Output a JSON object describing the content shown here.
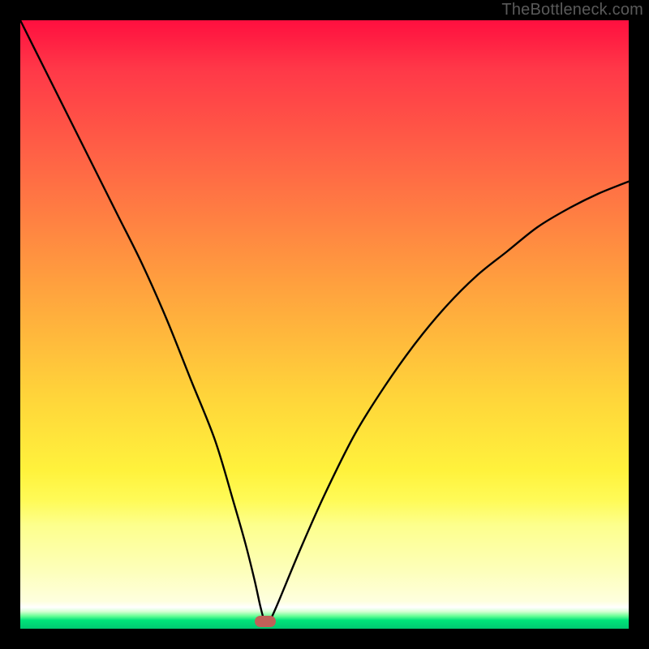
{
  "watermark": "TheBottleneck.com",
  "chart_data": {
    "type": "line",
    "title": "",
    "xlabel": "",
    "ylabel": "",
    "xlim": [
      0,
      100
    ],
    "ylim": [
      0,
      100
    ],
    "series": [
      {
        "name": "bottleneck-curve",
        "x": [
          0,
          4,
          8,
          12,
          16,
          20,
          24,
          28,
          32,
          35,
          37,
          38.5,
          39.5,
          40.2,
          41,
          42,
          46,
          50,
          55,
          60,
          65,
          70,
          75,
          80,
          85,
          90,
          95,
          100
        ],
        "values": [
          100,
          92,
          84,
          76,
          68,
          60,
          51,
          41,
          31,
          21,
          14,
          8,
          3.5,
          1.2,
          1.5,
          3.4,
          13,
          22,
          32,
          40,
          47,
          53,
          58,
          62,
          66,
          69,
          71.5,
          73.5
        ]
      }
    ],
    "marker": {
      "x": 40.2,
      "y": 1.2
    },
    "gradient_stops": [
      {
        "pct": 0,
        "color": "#ff0f3f"
      },
      {
        "pct": 8,
        "color": "#ff3848"
      },
      {
        "pct": 25,
        "color": "#ff6a45"
      },
      {
        "pct": 44,
        "color": "#ffa23e"
      },
      {
        "pct": 62,
        "color": "#ffd53a"
      },
      {
        "pct": 74,
        "color": "#fff23c"
      },
      {
        "pct": 79,
        "color": "#fffb58"
      },
      {
        "pct": 83,
        "color": "#fdff8d"
      },
      {
        "pct": 90,
        "color": "#fdffb7"
      },
      {
        "pct": 95.5,
        "color": "#feffde"
      },
      {
        "pct": 96.5,
        "color": "#ffffff"
      },
      {
        "pct": 97.2,
        "color": "#d4ffd2"
      },
      {
        "pct": 97.9,
        "color": "#6bff97"
      },
      {
        "pct": 98.6,
        "color": "#00e47a"
      },
      {
        "pct": 100,
        "color": "#00c871"
      }
    ]
  }
}
